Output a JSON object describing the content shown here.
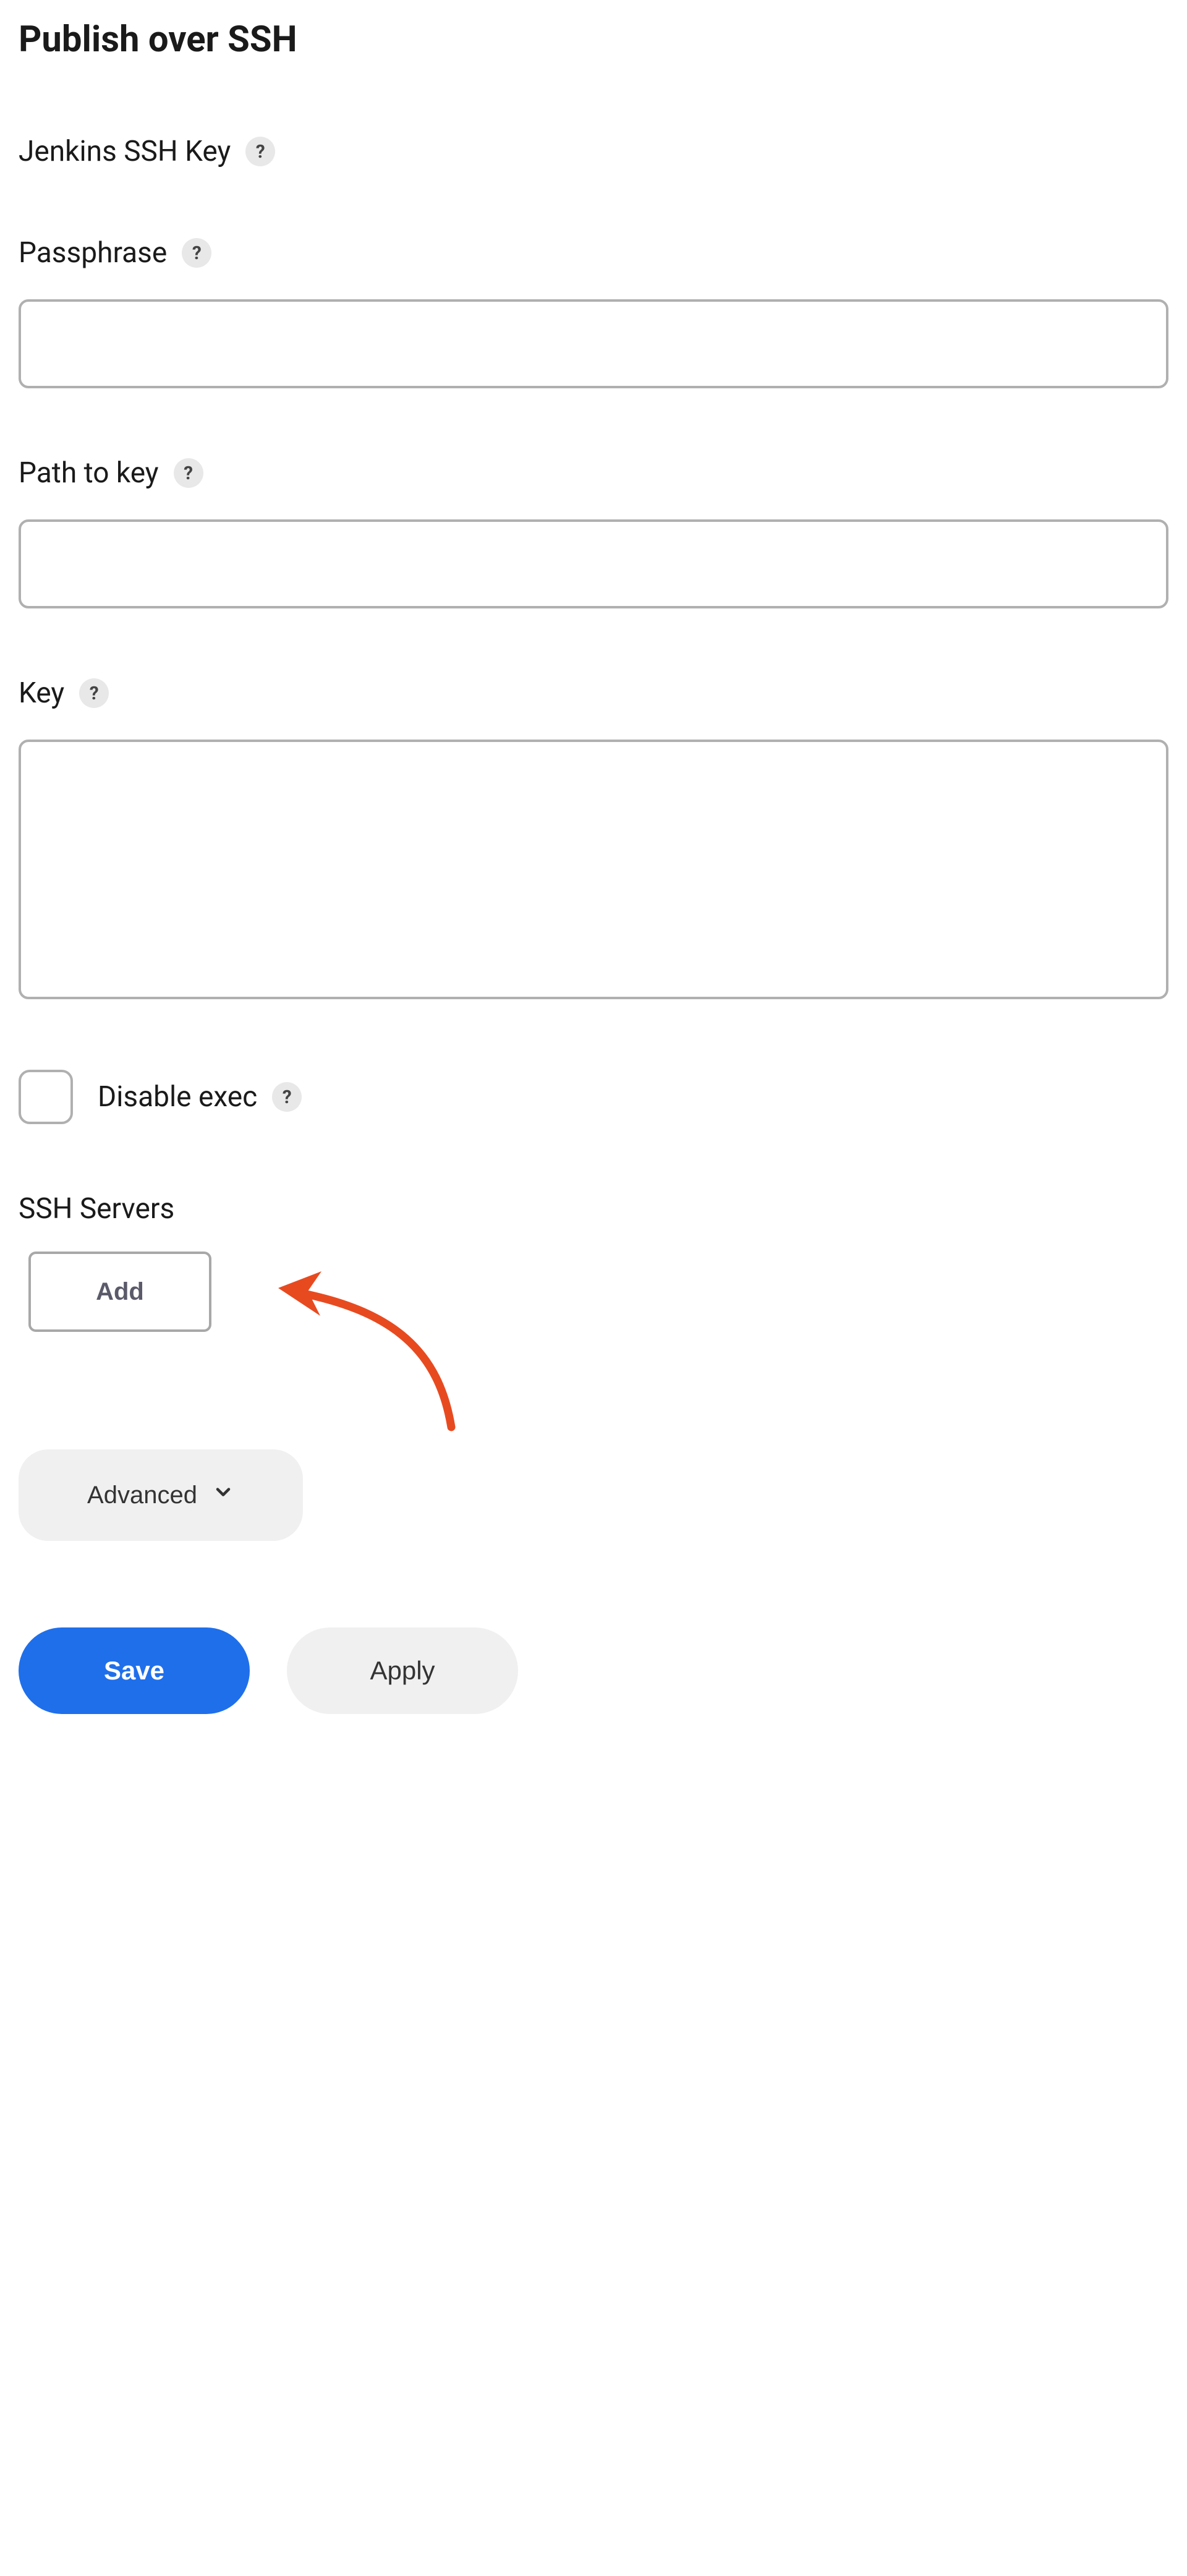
{
  "section": {
    "title": "Publish over SSH"
  },
  "jenkins_key": {
    "label": "Jenkins SSH Key"
  },
  "passphrase": {
    "label": "Passphrase",
    "value": ""
  },
  "path_to_key": {
    "label": "Path to key",
    "value": ""
  },
  "key": {
    "label": "Key",
    "value": ""
  },
  "disable_exec": {
    "label": "Disable exec",
    "checked": false
  },
  "ssh_servers": {
    "label": "SSH Servers",
    "add_button": "Add"
  },
  "advanced": {
    "label": "Advanced"
  },
  "buttons": {
    "save": "Save",
    "apply": "Apply"
  },
  "annotation": {
    "arrow_color": "#e84a20"
  }
}
